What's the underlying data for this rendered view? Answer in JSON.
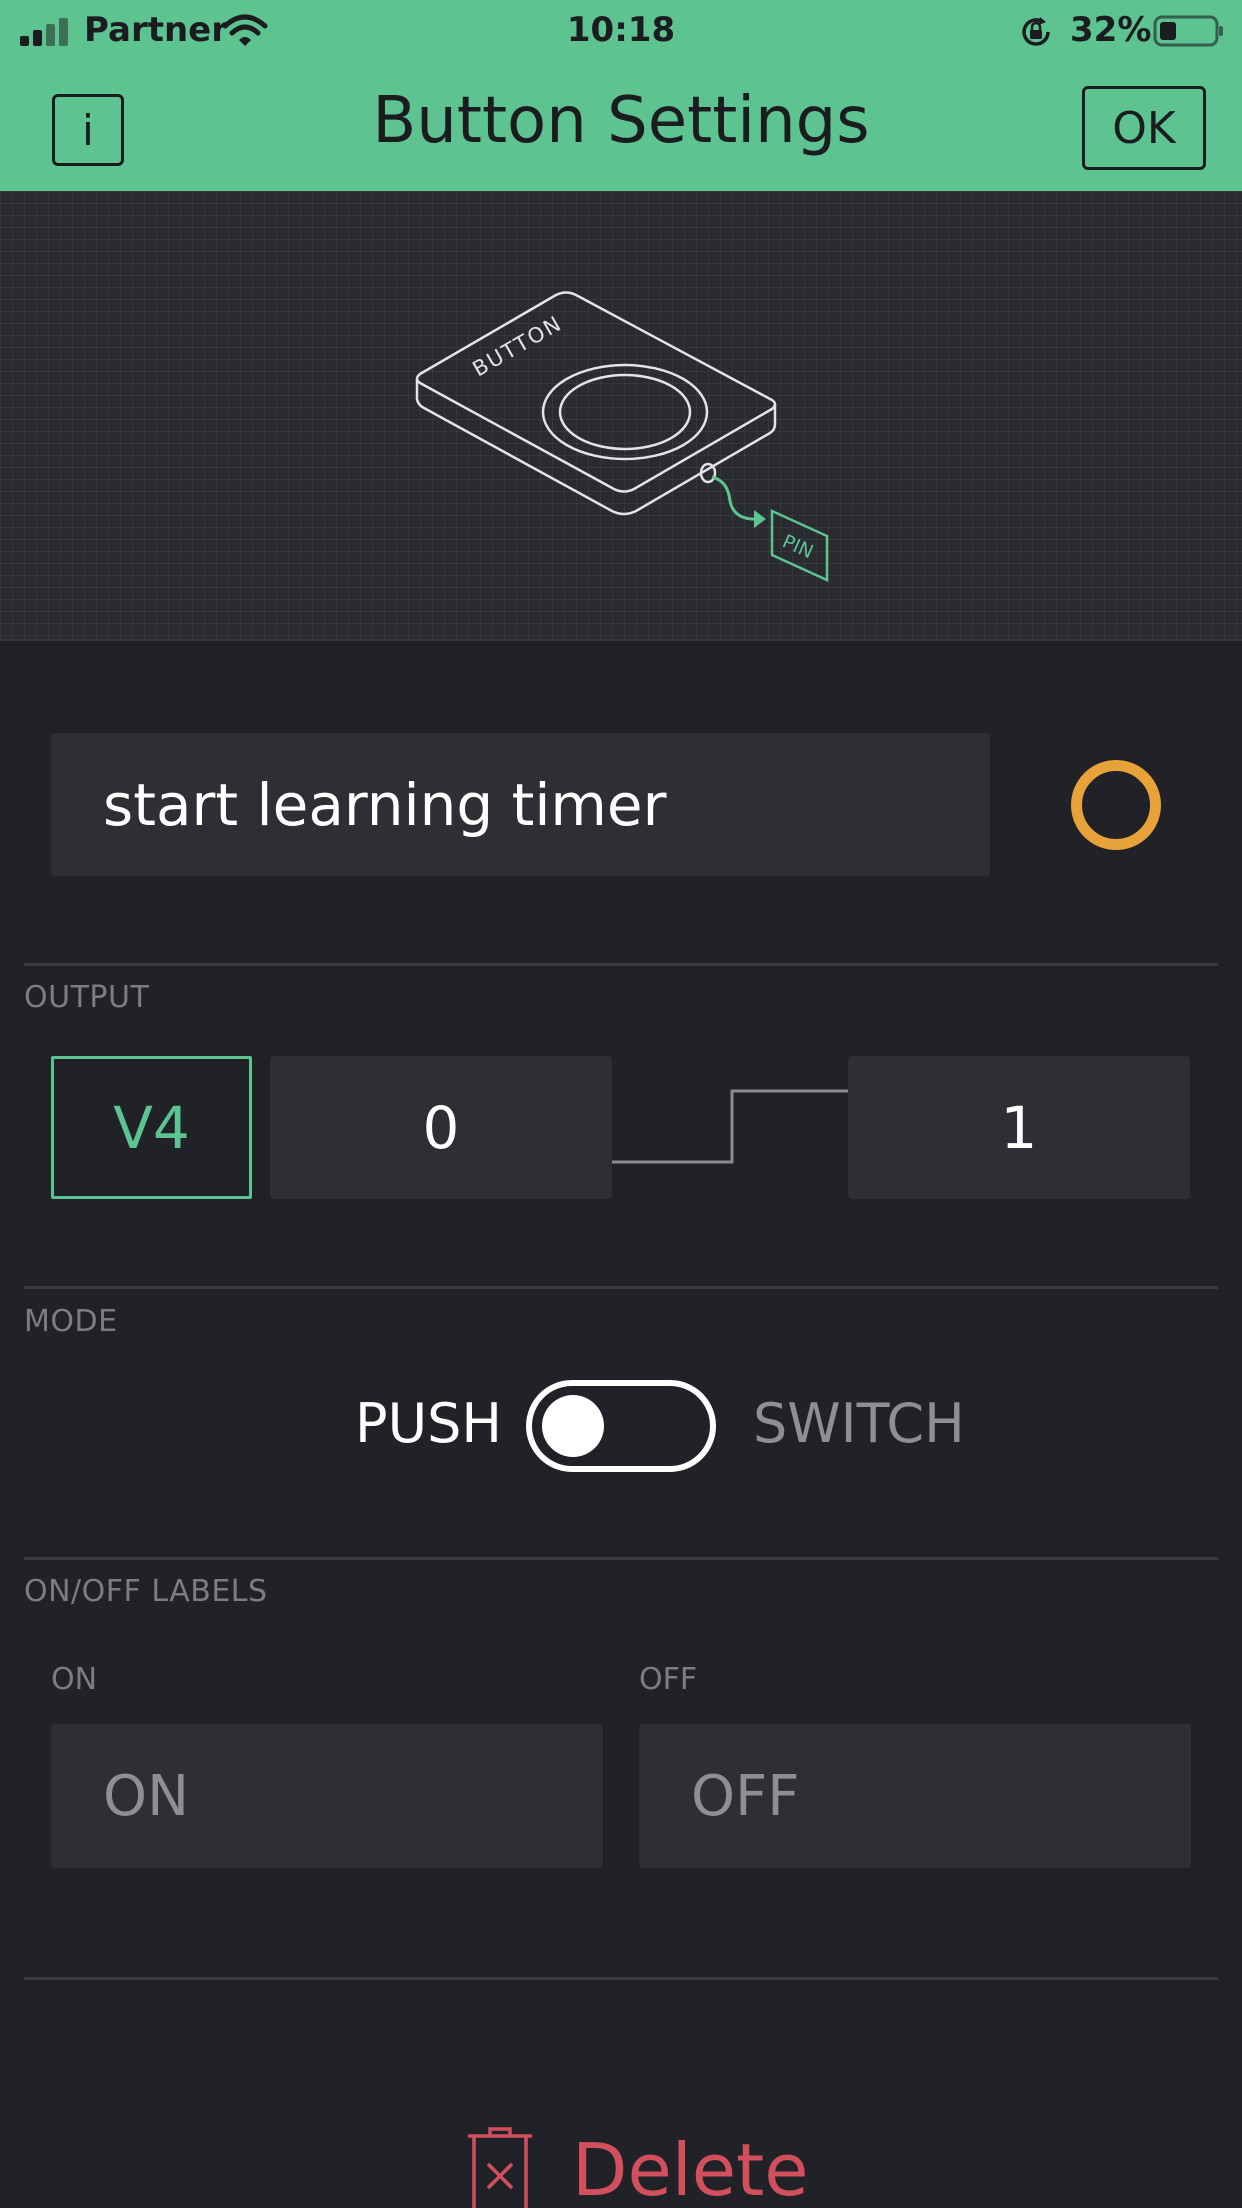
{
  "status_bar": {
    "carrier": "Partner",
    "time": "10:18",
    "battery_percent": "32%"
  },
  "header": {
    "info_label": "i",
    "title": "Button Settings",
    "ok_label": "OK"
  },
  "preview": {
    "device_label": "BUTTON",
    "pin_label": "PIN"
  },
  "name_field": {
    "value": "start learning timer"
  },
  "colors": {
    "accent": "#5cc391",
    "widget_color": "#e7a23a",
    "delete": "#d2505e",
    "background": "#212227"
  },
  "output": {
    "section_label": "OUTPUT",
    "pin": "V4",
    "low_value": "0",
    "high_value": "1"
  },
  "mode": {
    "section_label": "MODE",
    "push_label": "PUSH",
    "switch_label": "SWITCH",
    "selected": "PUSH"
  },
  "labels": {
    "section_label": "ON/OFF LABELS",
    "on_caption": "ON",
    "off_caption": "OFF",
    "on_placeholder": "ON",
    "off_placeholder": "OFF"
  },
  "delete": {
    "label": "Delete"
  }
}
